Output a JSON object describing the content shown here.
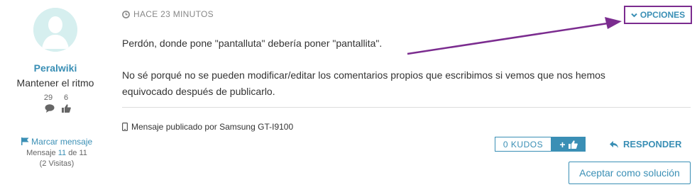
{
  "author": {
    "username": "Peralwiki",
    "rank": "Mantener el ritmo",
    "posts_count": "29",
    "kudos_count": "6",
    "flag_label": "Marcar mensaje",
    "message_label": "Mensaje",
    "message_index": "11",
    "message_of": "de",
    "message_total": "11",
    "views": "(2 Visitas)"
  },
  "post": {
    "timestamp": "HACE 23 MINUTOS",
    "options_label": "OPCIONES",
    "paragraph1": "Perdón, donde pone \"pantalluta\" debería poner \"pantallita\".",
    "paragraph2_line1": "No sé porqué no se pueden modificar/editar los comentarios propios que escribimos si vemos que nos hemos",
    "paragraph2_line2": "equivocado después de publicarlo.",
    "device": "Mensaje publicado por Samsung GT-I9100"
  },
  "actions": {
    "kudos_label": "0 KUDOS",
    "give_kudos_symbol": "+",
    "reply_label": "RESPONDER",
    "accept_label": "Aceptar como solución"
  },
  "colors": {
    "accent": "#3a8fb5",
    "annotation": "#7b2c8f"
  }
}
